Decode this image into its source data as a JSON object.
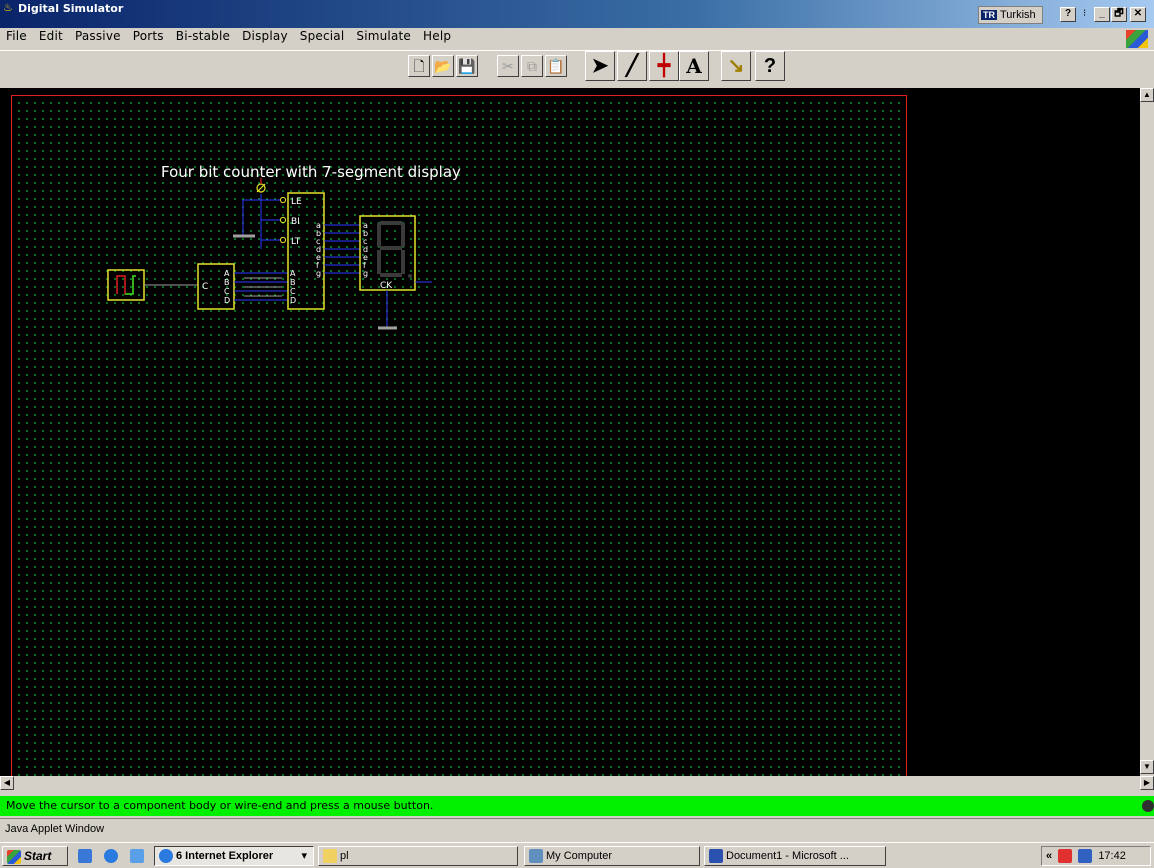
{
  "window": {
    "title": "Digital Simulator",
    "language_code": "TR",
    "language_label": "Turkish",
    "help_button": "?",
    "minimize_label": "_",
    "restore_label": "🗗",
    "close_label": "✕"
  },
  "menu": [
    "File",
    "Edit",
    "Passive",
    "Ports",
    "Bi-stable",
    "Display",
    "Special",
    "Simulate",
    "Help"
  ],
  "toolbar": {
    "tools": [
      "new",
      "open",
      "save",
      "cut",
      "copy",
      "paste",
      "select",
      "wire",
      "junction",
      "text",
      "probe",
      "help"
    ],
    "help_glyph": "?"
  },
  "circuit": {
    "title": "Four bit counter with 7-segment display",
    "counter_clock_label": "C",
    "counter_outputs": [
      "A",
      "B",
      "C",
      "D"
    ],
    "decoder_control_pins": [
      "LE",
      "BI",
      "LT"
    ],
    "decoder_inputs": [
      "A",
      "B",
      "C",
      "D"
    ],
    "decoder_outputs": [
      "a",
      "b",
      "c",
      "d",
      "e",
      "f",
      "g"
    ],
    "display_inputs": [
      "a",
      "b",
      "c",
      "d",
      "e",
      "f",
      "g"
    ],
    "display_ck_label": "CK",
    "colors": {
      "component_outline": "#e6e22a",
      "wire": "#2a3cff",
      "ground": "#a0a0a0",
      "grid_dot": "#0a8f28",
      "canvas_border": "#e02020",
      "segment_dim": "#3a3a3a"
    }
  },
  "status": {
    "message": "Move the cursor to a component body or wire-end and press a mouse button.",
    "applet_label": "Java Applet Window",
    "color": "#00f000"
  },
  "taskbar": {
    "start": "Start",
    "tasks": [
      "6 Internet Explorer",
      "pl",
      "My Computer",
      "Document1 - Microsoft ..."
    ],
    "tray_arrow": "«",
    "clock": "17:42"
  }
}
